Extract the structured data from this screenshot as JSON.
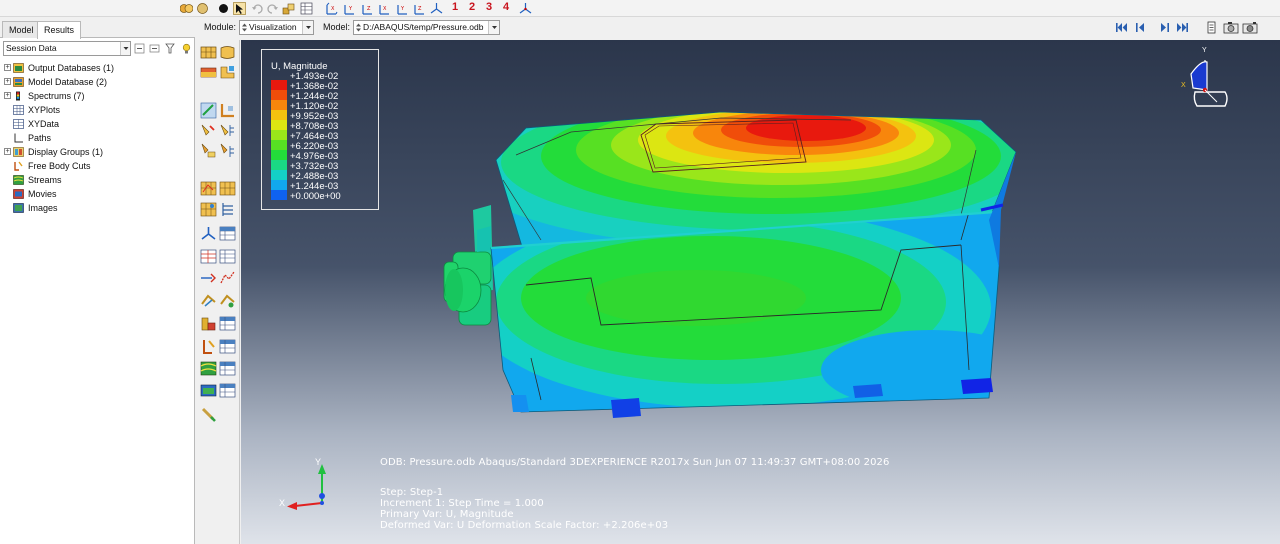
{
  "toolbar": {
    "view_numbers": [
      "1",
      "2",
      "3",
      "4"
    ]
  },
  "context_bar": {
    "module_label": "Module:",
    "module_value": "Visualization",
    "model_label": "Model:",
    "model_value": "D:/ABAQUS/temp/Pressure.odb"
  },
  "left_panel": {
    "tabs": [
      {
        "label": "Model",
        "active": false
      },
      {
        "label": "Results",
        "active": true
      }
    ],
    "session_select": "Session Data",
    "tree": [
      {
        "label": "Output Databases (1)",
        "expandable": true,
        "icon": "database-icon"
      },
      {
        "label": "Model Database (2)",
        "expandable": true,
        "icon": "model-database-icon"
      },
      {
        "label": "Spectrums (7)",
        "expandable": true,
        "icon": "spectrum-icon"
      },
      {
        "label": "XYPlots",
        "expandable": false,
        "icon": "xyplot-icon"
      },
      {
        "label": "XYData",
        "expandable": false,
        "icon": "xydata-icon"
      },
      {
        "label": "Paths",
        "expandable": false,
        "icon": "path-icon"
      },
      {
        "label": "Display Groups (1)",
        "expandable": true,
        "icon": "display-group-icon"
      },
      {
        "label": "Free Body Cuts",
        "expandable": false,
        "icon": "free-body-cut-icon"
      },
      {
        "label": "Streams",
        "expandable": false,
        "icon": "stream-icon"
      },
      {
        "label": "Movies",
        "expandable": false,
        "icon": "movie-icon"
      },
      {
        "label": "Images",
        "expandable": false,
        "icon": "image-icon"
      }
    ]
  },
  "legend": {
    "title": "U, Magnitude",
    "entries": [
      {
        "label": "+1.493e-02",
        "color": "#e8190e"
      },
      {
        "label": "+1.368e-02",
        "color": "#f04d0a"
      },
      {
        "label": "+1.244e-02",
        "color": "#f8860c"
      },
      {
        "label": "+1.120e-02",
        "color": "#f4c20f"
      },
      {
        "label": "+9.952e-03",
        "color": "#dce612"
      },
      {
        "label": "+8.708e-03",
        "color": "#9ae61a"
      },
      {
        "label": "+7.464e-03",
        "color": "#57e023"
      },
      {
        "label": "+6.220e-03",
        "color": "#23dc3a"
      },
      {
        "label": "+4.976e-03",
        "color": "#1ad884"
      },
      {
        "label": "+3.732e-03",
        "color": "#14d0c6"
      },
      {
        "label": "+2.488e-03",
        "color": "#11a8ee"
      },
      {
        "label": "+1.244e-03",
        "color": "#0f62f0"
      },
      {
        "label": "+0.000e+00",
        "color": "#1124e6"
      }
    ]
  },
  "triad": {
    "top_right_y": "Y",
    "top_right_x": "X",
    "bottom_left_y": "Y",
    "bottom_left_x": "X"
  },
  "info": {
    "odb_line": "ODB: Pressure.odb    Abaqus/Standard 3DEXPERIENCE R2017x    Sun Jun 07 11:49:37 GMT+08:00 2026",
    "step_line": "Step: Step-1",
    "increment_line": "Increment     1: Step Time =    1.000",
    "primary_line": "Primary Var: U, Magnitude",
    "deformed_line": "Deformed Var: U   Deformation Scale Factor: +2.206e+03"
  },
  "colors": {
    "viewport_top": "#2b364b",
    "viewport_bottom": "#dfe3ea",
    "accent_red": "#c8141e"
  }
}
